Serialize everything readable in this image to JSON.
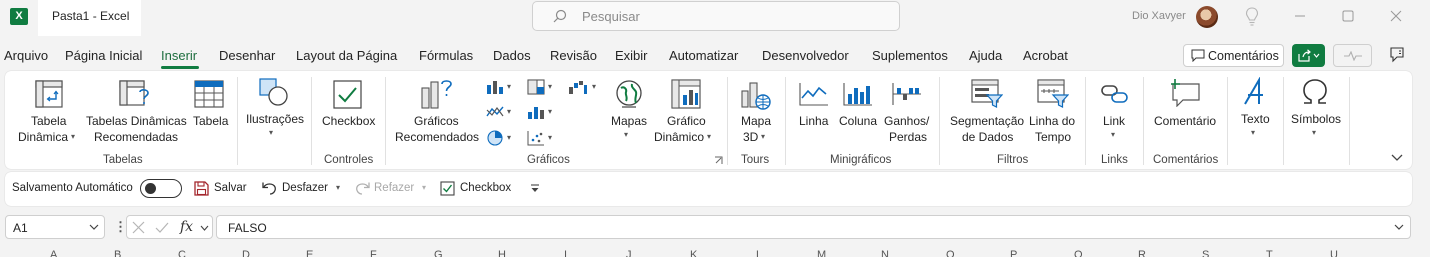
{
  "window": {
    "app_icon": "X",
    "title": "Pasta1  -  Excel",
    "search_placeholder": "Pesquisar",
    "user_name": "Dio Xavyer",
    "icons": [
      "search-icon",
      "lightbulb-icon",
      "minimize-icon",
      "maximize-icon",
      "close-icon"
    ]
  },
  "menu": {
    "tabs": [
      "Arquivo",
      "Página Inicial",
      "Inserir",
      "Desenhar",
      "Layout da Página",
      "Fórmulas",
      "Dados",
      "Revisão",
      "Exibir",
      "Automatizar",
      "Desenvolvedor",
      "Suplementos",
      "Ajuda",
      "Acrobat"
    ],
    "active_tab": "Inserir",
    "comments_button": "Comentários",
    "accent_color": "#107c41"
  },
  "ribbon": {
    "tabela_dinamica": [
      "Tabela",
      "Dinâmica"
    ],
    "tabelas_dinamicas_recomendadas": [
      "Tabelas Dinâmicas",
      "Recomendadas"
    ],
    "tabela": "Tabela",
    "ilustracoes": "Ilustrações",
    "checkbox": "Checkbox",
    "graficos_recomendados": [
      "Gráficos",
      "Recomendados"
    ],
    "mapas": "Mapas",
    "grafico_dinamico": [
      "Gráfico",
      "Dinâmico"
    ],
    "mapa_3d": [
      "Mapa",
      "3D"
    ],
    "linha": "Linha",
    "coluna": "Coluna",
    "ganhos_perdas": [
      "Ganhos/",
      "Perdas"
    ],
    "segmentacao": [
      "Segmentação",
      "de Dados"
    ],
    "linha_do_tempo": [
      "Linha do",
      "Tempo"
    ],
    "link": "Link",
    "comentario": "Comentário",
    "texto": "Texto",
    "simbolos": "Símbolos",
    "groups": {
      "tabelas": "Tabelas",
      "controles": "Controles",
      "graficos": "Gráficos",
      "tours": "Tours",
      "minigraficos": "Minigráficos",
      "filtros": "Filtros",
      "links": "Links",
      "comentarios": "Comentários"
    }
  },
  "qat": {
    "autosave": "Salvamento Automático",
    "autosave_state": "off",
    "save": "Salvar",
    "undo": "Desfazer",
    "redo": "Refazer",
    "checkbox": "Checkbox"
  },
  "formula_bar": {
    "name_box": "A1",
    "fx": "fx",
    "formula": "FALSO"
  },
  "columns": [
    "A",
    "B",
    "C",
    "D",
    "E",
    "F",
    "G",
    "H",
    "I",
    "J",
    "K",
    "L",
    "M",
    "N",
    "O",
    "P",
    "Q",
    "R",
    "S",
    "T",
    "U"
  ]
}
